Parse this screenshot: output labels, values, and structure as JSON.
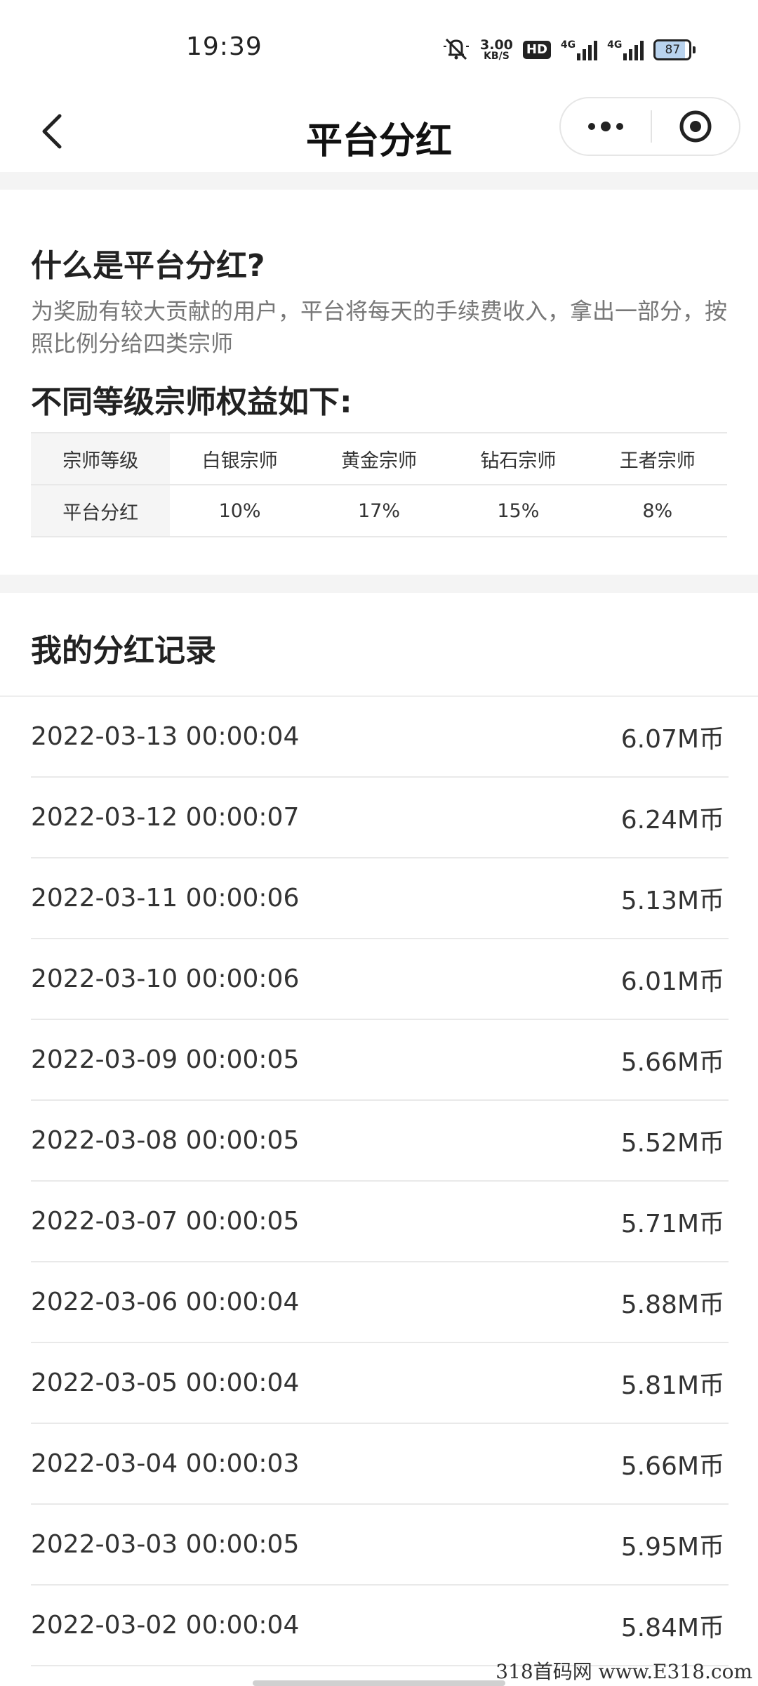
{
  "status_bar": {
    "time": "19:39",
    "speed_value": "3.00",
    "speed_unit": "KB/S",
    "hd_badge": "HD",
    "network_1": "4G",
    "network_2": "4G",
    "battery_level": "87",
    "icons": [
      "mute-icon",
      "signal-icon",
      "signal-icon",
      "battery-icon"
    ]
  },
  "navbar": {
    "title": "平台分红",
    "back_icon": "chevron-left-icon",
    "more_icon": "more-dots-icon",
    "close_icon": "target-circle-icon"
  },
  "intro": {
    "title": "什么是平台分红?",
    "description": "为奖励有较大贡献的用户，平台将每天的手续费收入，拿出一部分，按照比例分给四类宗师",
    "benefit_title": "不同等级宗师权益如下:"
  },
  "level_table": {
    "header_label": "宗师等级",
    "levels": [
      "白银宗师",
      "黄金宗师",
      "钻石宗师",
      "王者宗师"
    ],
    "row_label": "平台分红",
    "shares": [
      "10%",
      "17%",
      "15%",
      "8%"
    ]
  },
  "records": {
    "title": "我的分红记录",
    "items": [
      {
        "time": "2022-03-13 00:00:04",
        "amount": "6.07M币"
      },
      {
        "time": "2022-03-12 00:00:07",
        "amount": "6.24M币"
      },
      {
        "time": "2022-03-11 00:00:06",
        "amount": "5.13M币"
      },
      {
        "time": "2022-03-10 00:00:06",
        "amount": "6.01M币"
      },
      {
        "time": "2022-03-09 00:00:05",
        "amount": "5.66M币"
      },
      {
        "time": "2022-03-08 00:00:05",
        "amount": "5.52M币"
      },
      {
        "time": "2022-03-07 00:00:05",
        "amount": "5.71M币"
      },
      {
        "time": "2022-03-06 00:00:04",
        "amount": "5.88M币"
      },
      {
        "time": "2022-03-05 00:00:04",
        "amount": "5.81M币"
      },
      {
        "time": "2022-03-04 00:00:03",
        "amount": "5.66M币"
      },
      {
        "time": "2022-03-03 00:00:05",
        "amount": "5.95M币"
      },
      {
        "time": "2022-03-02 00:00:04",
        "amount": "5.84M币"
      }
    ]
  },
  "watermark": "318首码网 www.E318.com",
  "colors": {
    "background": "#ffffff",
    "section_gap": "#f4f4f4",
    "muted_text": "#777777",
    "table_head_bg": "#f5f5f5"
  }
}
